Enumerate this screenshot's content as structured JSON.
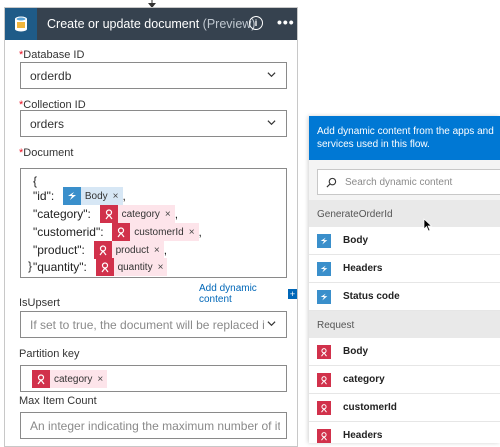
{
  "action": {
    "title": "Create or update document",
    "title_suffix": "(Preview)",
    "info_icon": "i",
    "more_icon": "•••"
  },
  "fields": {
    "database_id": {
      "label": "Database ID",
      "value": "orderdb"
    },
    "collection_id": {
      "label": "Collection ID",
      "value": "orders"
    },
    "document": {
      "label": "Document",
      "open_brace": "{",
      "close_brace": "}",
      "lines": [
        {
          "key": "\"id\":",
          "token": "Body",
          "token_type": "blue",
          "after": ","
        },
        {
          "key": "\"category\":",
          "token": "category",
          "token_type": "red",
          "after": ","
        },
        {
          "key": "\"customerid\":",
          "token": "customerId",
          "token_type": "red",
          "after": ","
        },
        {
          "key": "\"product\":",
          "token": "product",
          "token_type": "red",
          "after": ","
        },
        {
          "key": "\"quantity\":",
          "token": "quantity",
          "token_type": "red",
          "after": ""
        }
      ]
    },
    "add_dynamic_content": "Add dynamic content",
    "add_dynamic_plus": "+",
    "is_upsert": {
      "label": "IsUpsert",
      "placeholder": "If set to true, the document will be replaced if it exists else"
    },
    "partition_key": {
      "label": "Partition key",
      "token": "category"
    },
    "max_item_count": {
      "label": "Max Item Count",
      "placeholder": "An integer indicating the maximum number of items to be retu"
    }
  },
  "token_remove": "×",
  "dynamic_panel": {
    "header": "Add dynamic content from the apps and services used in this flow.",
    "search_placeholder": "Search dynamic content",
    "groups": [
      {
        "title": "GenerateOrderId",
        "items": [
          "Body",
          "Headers",
          "Status code"
        ],
        "icon": "blue"
      },
      {
        "title": "Request",
        "items": [
          "Body",
          "category",
          "customerId",
          "Headers"
        ],
        "icon": "red"
      }
    ]
  },
  "colors": {
    "header_bg": "#36424f",
    "accent_blue": "#0078d4",
    "token_red": "#d1314b",
    "token_blue": "#3a8fcb"
  }
}
